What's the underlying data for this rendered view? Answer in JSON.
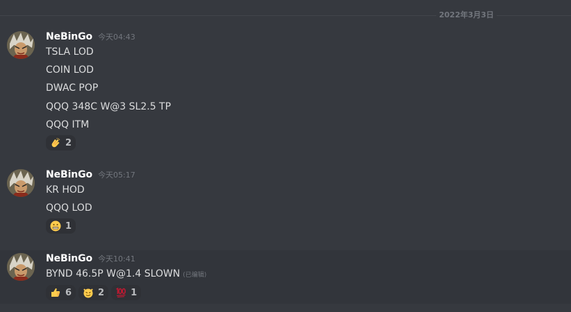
{
  "date_divider": "2022年3月3日",
  "colors": {
    "background": "#36393f",
    "username": "#ffffff",
    "text": "#dcddde",
    "muted": "#72767d",
    "reaction_bg": "#2f3136"
  },
  "messages": [
    {
      "username": "NeBinGo",
      "timestamp": "今天04:43",
      "lines": [
        "TSLA LOD",
        "COIN LOD",
        "DWAC POP",
        "QQQ 348C W@3 SL2.5 TP",
        "QQQ ITM"
      ],
      "reactions": [
        {
          "emoji": "clapping-hands-icon",
          "count": "2"
        }
      ]
    },
    {
      "username": "NeBinGo",
      "timestamp": "今天05:17",
      "lines": [
        "KR HOD",
        "QQQ LOD"
      ],
      "reactions": [
        {
          "emoji": "grimacing-face-icon",
          "count": "1"
        }
      ]
    },
    {
      "username": "NeBinGo",
      "timestamp": "今天10:41",
      "lines": [
        "BYND 46.5P W@1.4 SLOWN"
      ],
      "edited": "(已编辑)",
      "reactions": [
        {
          "emoji": "thumbs-up-icon",
          "count": "6"
        },
        {
          "emoji": "smirking-devil-icon",
          "count": "2"
        },
        {
          "emoji": "hundred-points-icon",
          "count": "1"
        }
      ]
    }
  ]
}
